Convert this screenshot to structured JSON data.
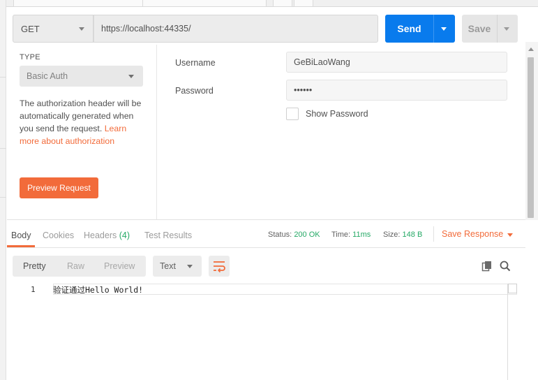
{
  "request": {
    "method": "GET",
    "url": "https://localhost:44335/",
    "send_label": "Send",
    "save_label": "Save"
  },
  "auth": {
    "type_label": "TYPE",
    "type_value": "Basic Auth",
    "description": "The authorization header will be automatically generated when you send the request.",
    "learn_more_link": "Learn more about authorization",
    "preview_button": "Preview Request",
    "username_label": "Username",
    "username_value": "GeBiLaoWang",
    "password_label": "Password",
    "password_value": "••••••",
    "show_password_label": "Show Password"
  },
  "response": {
    "tabs": [
      {
        "label": "Body"
      },
      {
        "label": "Cookies"
      },
      {
        "label": "Headers",
        "count": "(4)"
      },
      {
        "label": "Test Results"
      }
    ],
    "status_label": "Status:",
    "status_value": "200 OK",
    "time_label": "Time:",
    "time_value": "11ms",
    "size_label": "Size:",
    "size_value": "148 B",
    "save_response_label": "Save Response",
    "view_modes": [
      "Pretty",
      "Raw",
      "Preview"
    ],
    "format": "Text",
    "lines": [
      {
        "num": "1",
        "text": "验证通过Hello World!"
      }
    ]
  },
  "colors": {
    "accent": "#f26b3a",
    "send_blue": "#097bed",
    "status_green": "#25a966"
  },
  "icons": {
    "wrap": "wrap-lines-icon",
    "copy": "copy-icon",
    "search": "search-icon"
  }
}
